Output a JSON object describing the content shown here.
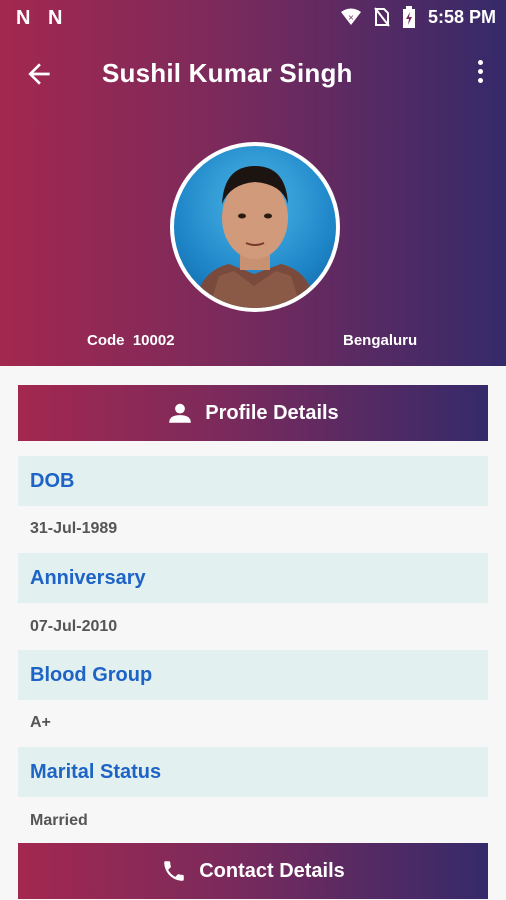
{
  "status_bar": {
    "left_icons": [
      "N",
      "N"
    ],
    "icons": [
      "wifi-icon",
      "no-sim-icon",
      "battery-icon"
    ],
    "time": "5:58 PM"
  },
  "app_bar": {
    "title": "Sushil Kumar Singh",
    "icons": [
      "back-arrow-icon",
      "more-vert-icon"
    ]
  },
  "profile_header": {
    "code_label": "Code",
    "code_value": "10002",
    "location": "Bengaluru"
  },
  "sections": {
    "profile_details": "Profile Details",
    "contact_details": "Contact Details"
  },
  "fields": [
    {
      "label": "DOB",
      "value": "31-Jul-1989"
    },
    {
      "label": "Anniversary",
      "value": "07-Jul-2010"
    },
    {
      "label": "Blood Group",
      "value": "A+"
    },
    {
      "label": "Marital Status",
      "value": "Married"
    }
  ],
  "colors": {
    "gradient_start": "#a3284f",
    "gradient_end": "#352a6a",
    "label_bg": "#e2f1f0",
    "label_text": "#1e63c6"
  }
}
